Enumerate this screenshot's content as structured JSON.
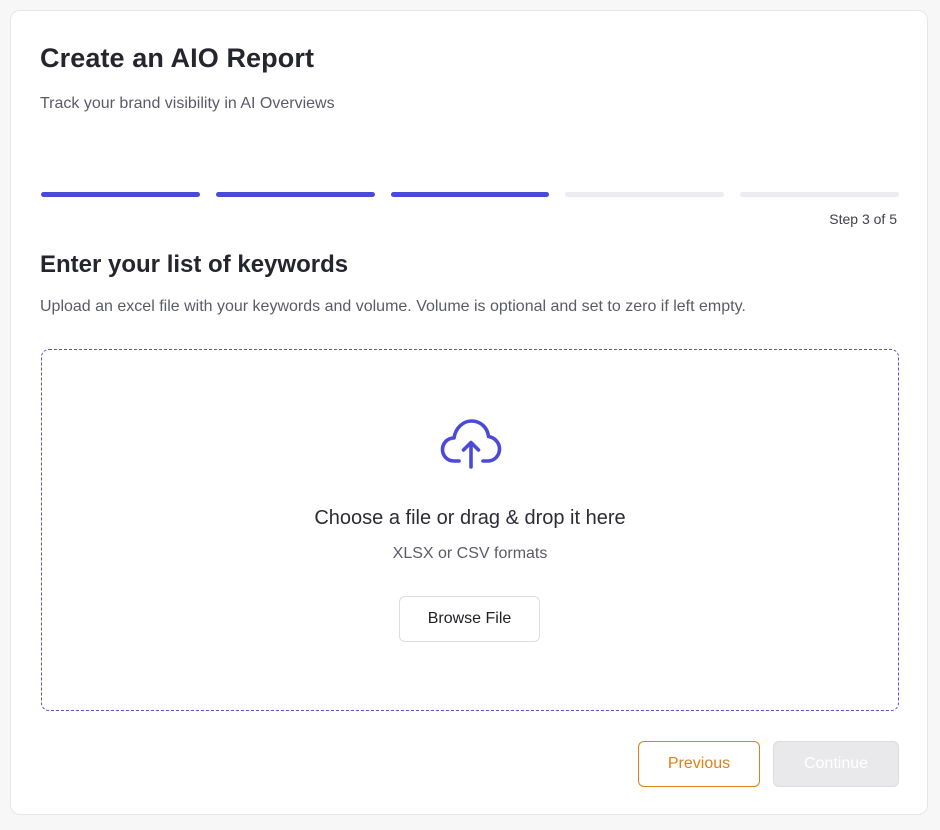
{
  "header": {
    "title": "Create an AIO Report",
    "subtitle": "Track your brand visibility in AI Overviews"
  },
  "progress": {
    "current_step": 3,
    "total_steps": 5,
    "label": "Step 3 of 5"
  },
  "section": {
    "title": "Enter your list of keywords",
    "description": "Upload an excel file with your keywords and volume. Volume is optional and set to zero if left empty."
  },
  "dropzone": {
    "icon": "cloud-upload-icon",
    "prompt": "Choose a file or drag & drop it here",
    "formats": "XLSX or CSV formats",
    "browse_label": "Browse File"
  },
  "footer": {
    "previous_label": "Previous",
    "continue_label": "Continue"
  },
  "colors": {
    "accent": "#4b49d9",
    "previous": "#e0801a",
    "disabled": "#e9e9ec"
  }
}
